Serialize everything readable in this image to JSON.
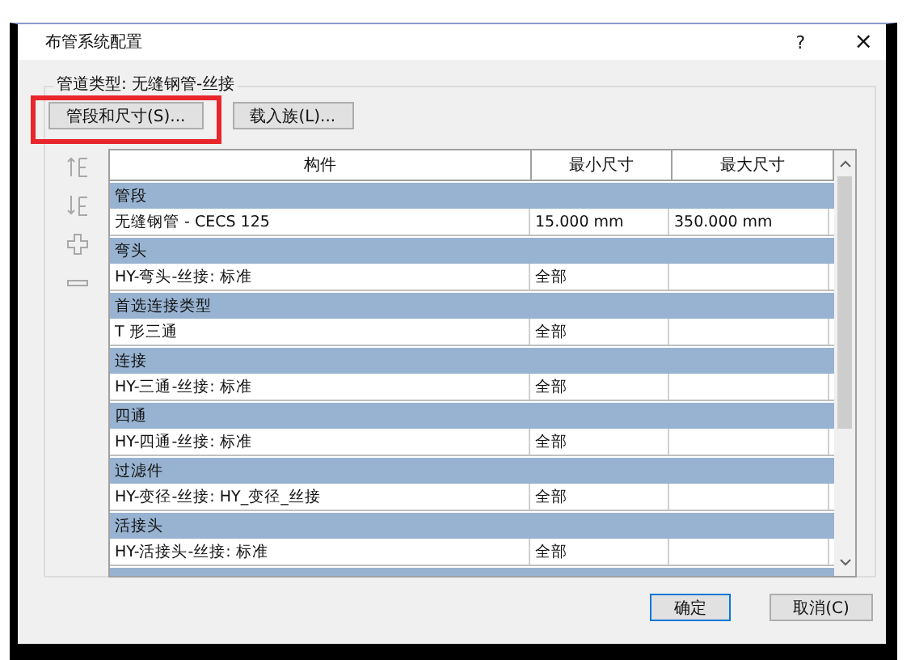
{
  "window": {
    "title": "布管系统配置",
    "help": "?",
    "close": "×"
  },
  "pipe_type": "管道类型: 无缝钢管-丝接",
  "top_buttons": [
    {
      "label": "管段和尺寸(S)...",
      "highlighted": true
    },
    {
      "label": "载入族(L)...",
      "highlighted": false
    }
  ],
  "side_tools": [
    {
      "kind": "up"
    },
    {
      "kind": "down"
    },
    {
      "kind": "add"
    },
    {
      "kind": "remove"
    }
  ],
  "table": {
    "columns": [
      "构件",
      "最小尺寸",
      "最大尺寸"
    ],
    "groups": [
      {
        "name": "管段",
        "part": "无缝钢管 - CECS 125",
        "min": "15.000 mm",
        "max": "350.000 mm"
      },
      {
        "name": "弯头",
        "part": "HY-弯头-丝接: 标准",
        "min": "全部"
      },
      {
        "name": "首选连接类型",
        "part": "T 形三通",
        "min": "全部"
      },
      {
        "name": "连接",
        "part": "HY-三通-丝接: 标准",
        "min": "全部"
      },
      {
        "name": "四通",
        "part": "HY-四通-丝接: 标准",
        "min": "全部"
      },
      {
        "name": "过滤件",
        "part": "HY-变径-丝接: HY_变径_丝接",
        "min": "全部"
      },
      {
        "name": "活接头",
        "part": "HY-活接头-丝接: 标准",
        "min": "全部"
      }
    ]
  },
  "footer_buttons": [
    {
      "label": "确定",
      "default": true
    },
    {
      "label": "取消(C)",
      "default": false
    }
  ]
}
